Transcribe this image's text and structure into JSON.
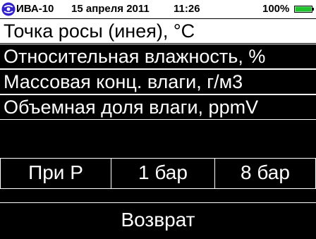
{
  "status_bar": {
    "device_name": "ИВА-10",
    "date": "15 апреля 2011",
    "time": "11:26",
    "battery_level": "100%",
    "battery_fill_fraction": 1.0,
    "battery_color": "#1fc42f",
    "logo_color": "#3322cc"
  },
  "menu": {
    "items": [
      {
        "label": "Точка росы (инея), °C",
        "selected": true
      },
      {
        "label": "Относительная влажность, %",
        "selected": false
      },
      {
        "label": "Массовая конц. влаги, г/м3",
        "selected": false
      },
      {
        "label": "Объемная доля влаги, ppmV",
        "selected": false
      }
    ]
  },
  "pressure_options": [
    "При P",
    "1 бар",
    "8 бар"
  ],
  "back_label": "Возврат"
}
